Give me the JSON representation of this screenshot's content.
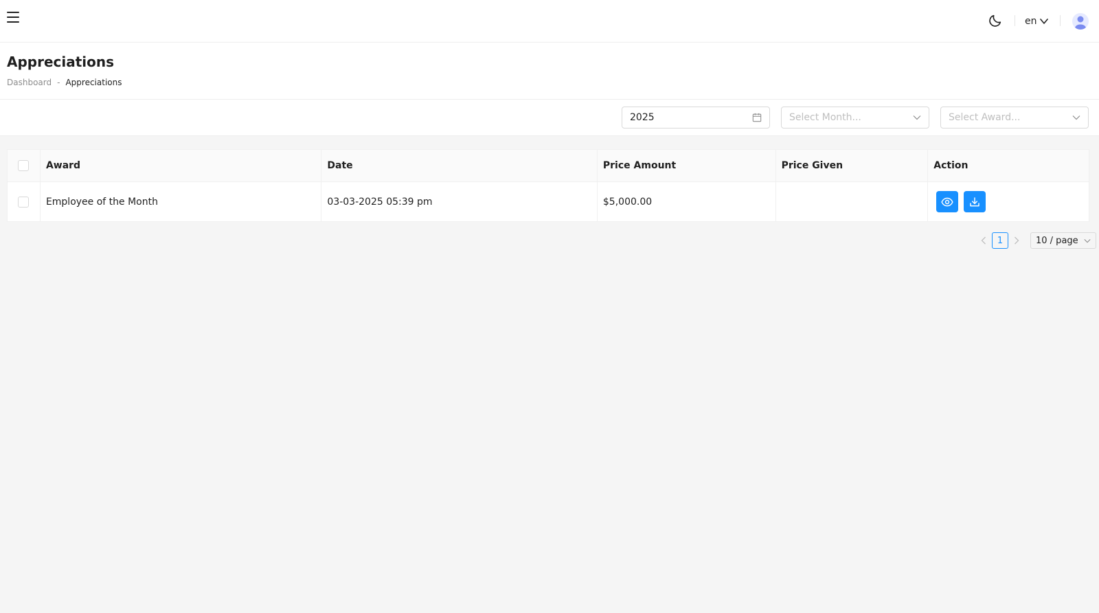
{
  "header": {
    "language": "en",
    "icons": {
      "menu": "hamburger-menu-icon",
      "theme": "moon-icon",
      "language_chevron": "chevron-down-icon",
      "avatar": "user-avatar-icon"
    }
  },
  "page": {
    "title": "Appreciations",
    "breadcrumb": {
      "home": "Dashboard",
      "separator": "-",
      "current": "Appreciations"
    }
  },
  "filters": {
    "year_value": "2025",
    "month_placeholder": "Select Month...",
    "award_placeholder": "Select Award..."
  },
  "table": {
    "columns": [
      "Award",
      "Date",
      "Price Amount",
      "Price Given",
      "Action"
    ],
    "rows": [
      {
        "award": "Employee of the Month",
        "date": "03-03-2025 05:39 pm",
        "price_amount": "$5,000.00",
        "price_given": ""
      }
    ],
    "actions": [
      "view-icon",
      "download-icon"
    ]
  },
  "pagination": {
    "current_page": "1",
    "page_size": "10 / page"
  },
  "colors": {
    "primary": "#1890ff",
    "background": "#f5f5f5",
    "surface": "#ffffff",
    "border": "#f0f0f0",
    "placeholder": "#bfbfbf",
    "muted_text": "#8c8c8c"
  }
}
